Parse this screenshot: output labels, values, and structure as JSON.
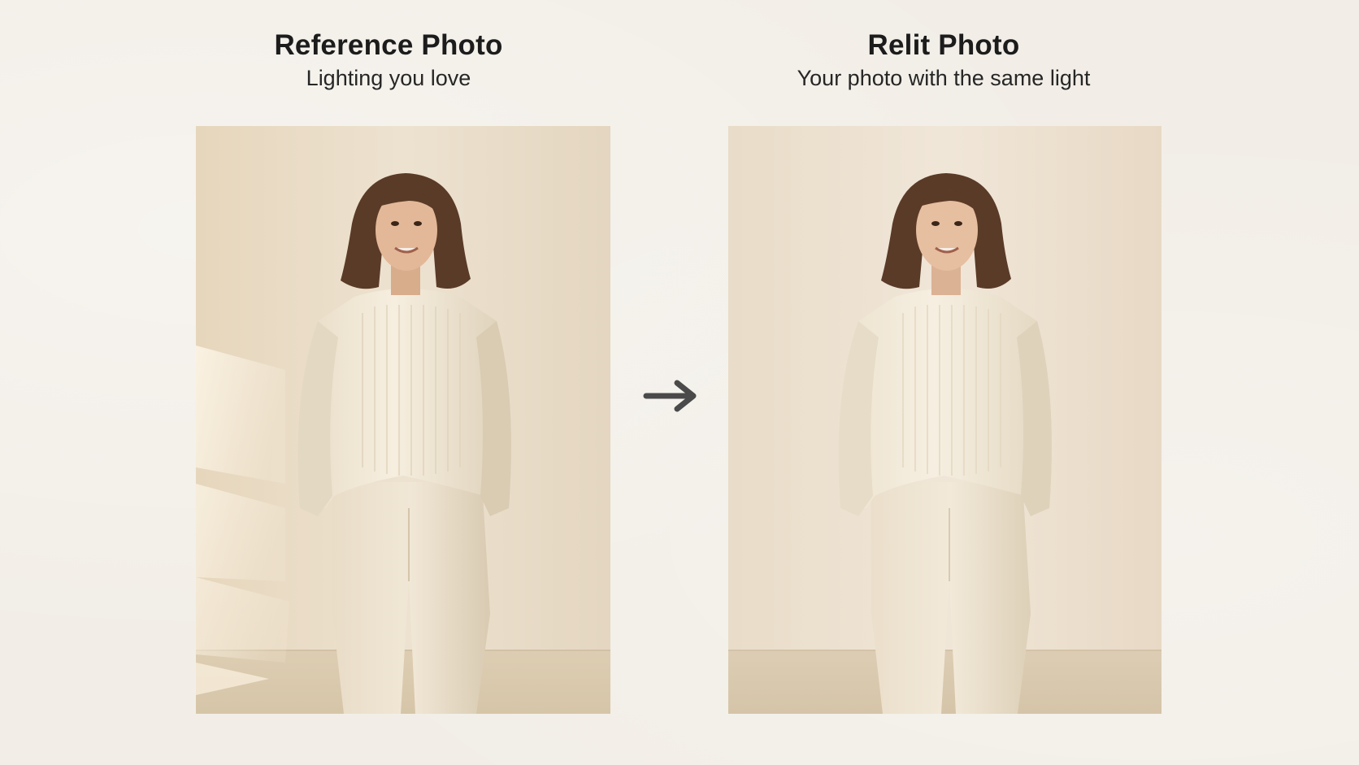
{
  "reference": {
    "title": "Reference Photo",
    "subtitle": "Lighting you love"
  },
  "relit": {
    "title": "Relit Photo",
    "subtitle": "Your photo with the same light"
  },
  "icons": {
    "arrow": "arrow-right-icon"
  },
  "colors": {
    "background": "#f2eee7",
    "text": "#1c1c1c",
    "arrow": "#4a4a4a",
    "reference_wall": "#e9dcc6",
    "relit_wall": "#ece0cf",
    "sweater": "#efe4d0",
    "trousers": "#eadcc6",
    "hair": "#5a3b27"
  }
}
